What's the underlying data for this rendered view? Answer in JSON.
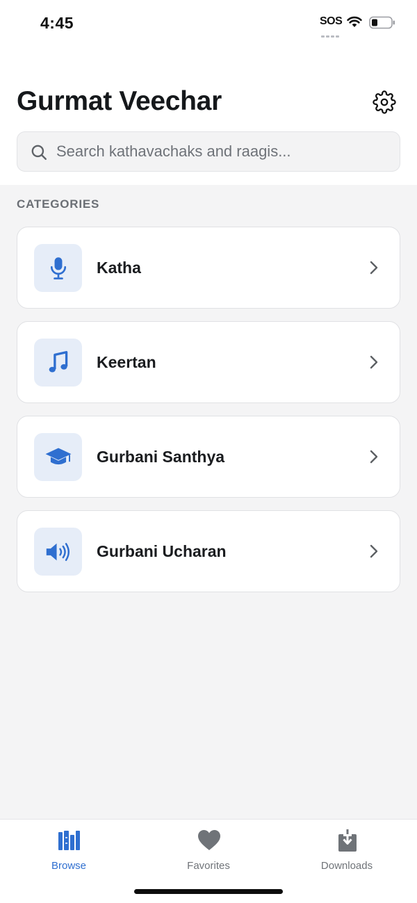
{
  "status_bar": {
    "time": "4:45",
    "sos": "SOS",
    "icons": [
      "wifi-icon",
      "battery-icon"
    ]
  },
  "header": {
    "title": "Gurmat Veechar",
    "settings_icon": "gear-icon"
  },
  "search": {
    "placeholder": "Search kathavachaks and raagis...",
    "value": "",
    "icon": "search-icon"
  },
  "categories": {
    "heading": "CATEGORIES",
    "items": [
      {
        "label": "Katha",
        "icon": "microphone-icon"
      },
      {
        "label": "Keertan",
        "icon": "music-note-icon"
      },
      {
        "label": "Gurbani Santhya",
        "icon": "graduation-cap-icon"
      },
      {
        "label": "Gurbani Ucharan",
        "icon": "speaker-volume-icon"
      }
    ]
  },
  "tab_bar": {
    "tabs": [
      {
        "label": "Browse",
        "icon": "library-books-icon",
        "active": true
      },
      {
        "label": "Favorites",
        "icon": "heart-icon",
        "active": false
      },
      {
        "label": "Downloads",
        "icon": "download-icon",
        "active": false
      }
    ]
  },
  "colors": {
    "accent": "#2f6fd0",
    "icon_tile_bg": "#e6edf8",
    "inactive_tab": "#6f7378",
    "page_bg": "#f4f4f5"
  }
}
